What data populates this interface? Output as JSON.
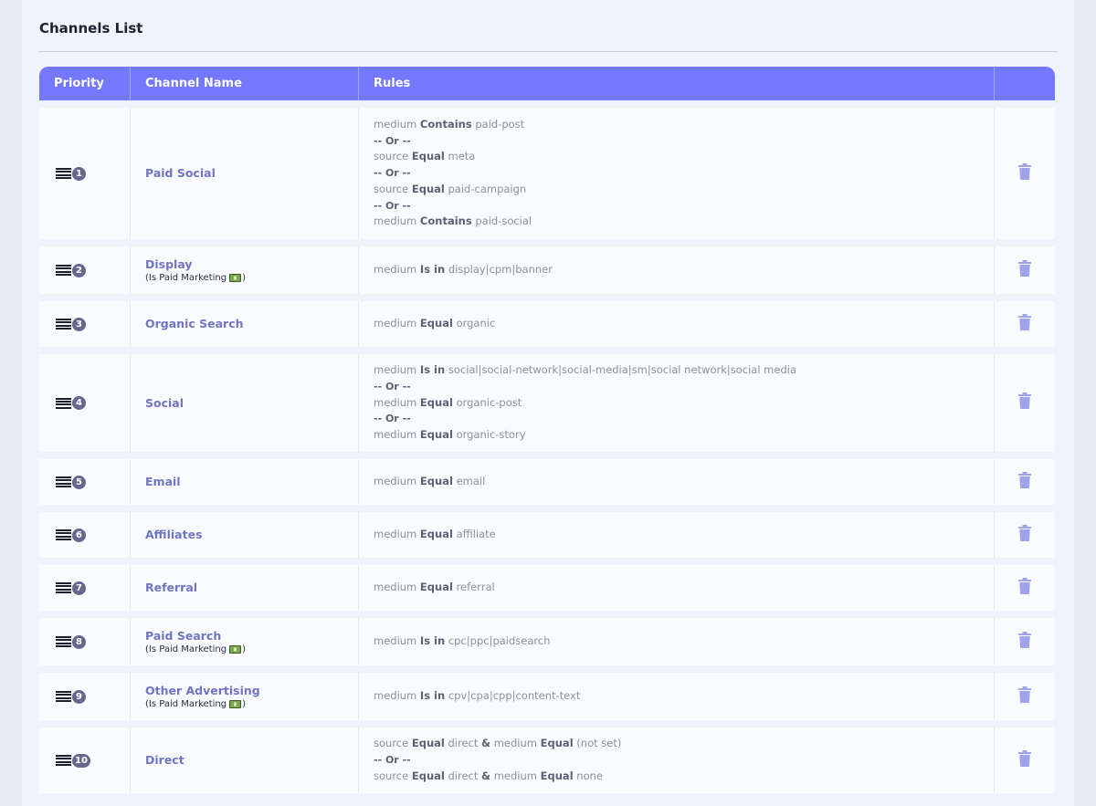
{
  "page": {
    "title": "Channels List"
  },
  "table": {
    "headers": {
      "priority": "Priority",
      "channel_name": "Channel Name",
      "rules": "Rules",
      "actions": ""
    },
    "paid_tag": {
      "prefix": "(Is Paid Marketing",
      "suffix": ")"
    },
    "or_separator": "-- Or --",
    "rows": [
      {
        "priority": "1",
        "name": "Paid Social",
        "paid": false,
        "rules": [
          [
            {
              "field": "medium",
              "op": "Contains",
              "value": "paid-post"
            }
          ],
          [
            {
              "field": "source",
              "op": "Equal",
              "value": "meta"
            }
          ],
          [
            {
              "field": "source",
              "op": "Equal",
              "value": "paid-campaign"
            }
          ],
          [
            {
              "field": "medium",
              "op": "Contains",
              "value": "paid-social"
            }
          ]
        ]
      },
      {
        "priority": "2",
        "name": "Display",
        "paid": true,
        "rules": [
          [
            {
              "field": "medium",
              "op": "Is in",
              "value": "display|cpm|banner"
            }
          ]
        ]
      },
      {
        "priority": "3",
        "name": "Organic Search",
        "paid": false,
        "rules": [
          [
            {
              "field": "medium",
              "op": "Equal",
              "value": "organic"
            }
          ]
        ]
      },
      {
        "priority": "4",
        "name": "Social",
        "paid": false,
        "rules": [
          [
            {
              "field": "medium",
              "op": "Is in",
              "value": "social|social-network|social-media|sm|social network|social media"
            }
          ],
          [
            {
              "field": "medium",
              "op": "Equal",
              "value": "organic-post"
            }
          ],
          [
            {
              "field": "medium",
              "op": "Equal",
              "value": "organic-story"
            }
          ]
        ]
      },
      {
        "priority": "5",
        "name": "Email",
        "paid": false,
        "rules": [
          [
            {
              "field": "medium",
              "op": "Equal",
              "value": "email"
            }
          ]
        ]
      },
      {
        "priority": "6",
        "name": "Affiliates",
        "paid": false,
        "rules": [
          [
            {
              "field": "medium",
              "op": "Equal",
              "value": "affiliate"
            }
          ]
        ]
      },
      {
        "priority": "7",
        "name": "Referral",
        "paid": false,
        "rules": [
          [
            {
              "field": "medium",
              "op": "Equal",
              "value": "referral"
            }
          ]
        ]
      },
      {
        "priority": "8",
        "name": "Paid Search",
        "paid": true,
        "rules": [
          [
            {
              "field": "medium",
              "op": "Is in",
              "value": "cpc|ppc|paidsearch"
            }
          ]
        ]
      },
      {
        "priority": "9",
        "name": "Other Advertising",
        "paid": true,
        "rules": [
          [
            {
              "field": "medium",
              "op": "Is in",
              "value": "cpv|cpa|cpp|content-text"
            }
          ]
        ]
      },
      {
        "priority": "10",
        "name": "Direct",
        "paid": false,
        "rules": [
          [
            {
              "field": "source",
              "op": "Equal",
              "value": "direct"
            },
            {
              "field": "medium",
              "op": "Equal",
              "value": "(not set)"
            }
          ],
          [
            {
              "field": "source",
              "op": "Equal",
              "value": "direct"
            },
            {
              "field": "medium",
              "op": "Equal",
              "value": "none"
            }
          ]
        ]
      }
    ],
    "and_joiner": "&"
  },
  "icons": {
    "drag": "drag-handle-icon",
    "delete": "trash-icon",
    "paid": "money-icon"
  },
  "colors": {
    "header_bg": "#7478fa",
    "channel_name": "#7075c2",
    "trash": "#9ea3ea",
    "badge": "#66678c"
  }
}
